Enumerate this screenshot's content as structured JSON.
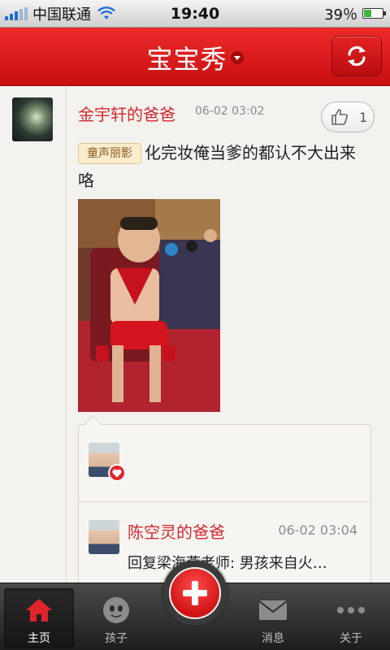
{
  "status_bar": {
    "carrier": "中国联通",
    "time": "19:40",
    "battery": "39％",
    "battery_level": 0.39
  },
  "nav": {
    "title": "宝宝秀"
  },
  "post": {
    "author": "金宇轩的爸爸",
    "time": "06-02 03:02",
    "like_count": "1",
    "tag": "童声丽影",
    "text": "化完妆俺当爹的都认不大出来咯"
  },
  "comment": {
    "author": "陈空灵的爸爸",
    "time": "06-02 03:04",
    "text": "回复梁海燕老师: 男孩来自火…"
  },
  "tabs": [
    {
      "label": "主页",
      "icon": "home-icon",
      "active": true
    },
    {
      "label": "孩子",
      "icon": "face-icon",
      "active": false
    },
    {
      "label": "消息",
      "icon": "mail-icon",
      "active": false
    },
    {
      "label": "关于",
      "icon": "more-icon",
      "active": false
    }
  ],
  "colors": {
    "brand_red": "#d3282f",
    "nav_red": "#e21d20"
  }
}
